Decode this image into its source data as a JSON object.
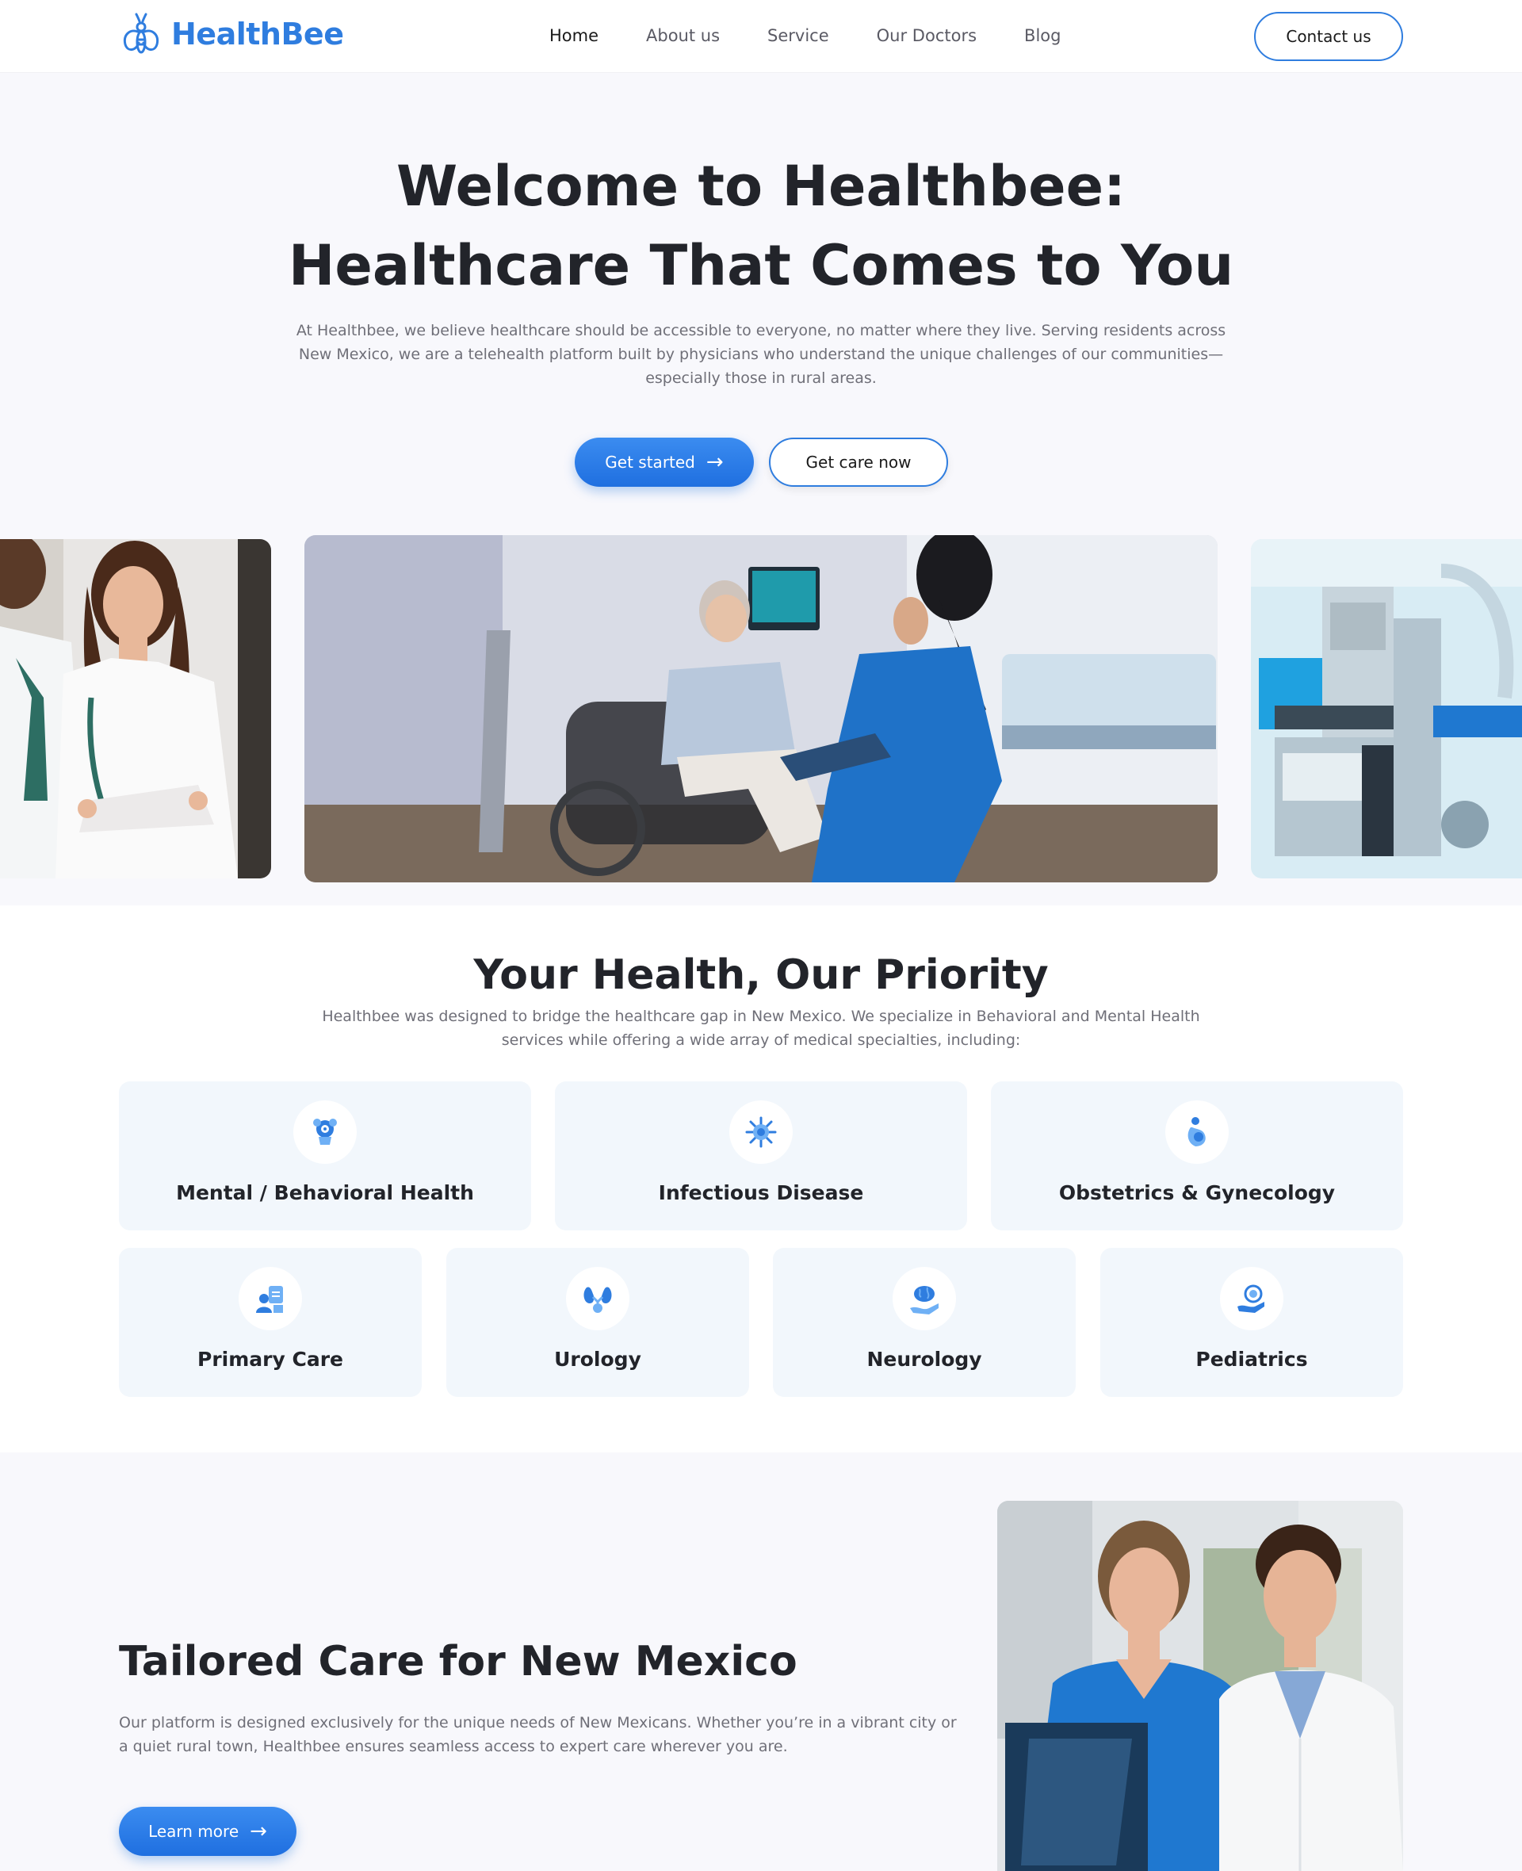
{
  "header": {
    "logo_text": "HealthBee",
    "nav": [
      "Home",
      "About us",
      "Service",
      "Our Doctors",
      "Blog"
    ],
    "contact_label": "Contact us"
  },
  "hero": {
    "title_line1": "Welcome to Healthbee:",
    "title_line2": "Healthcare That Comes to You",
    "description": "At Healthbee, we believe healthcare should be accessible to everyone, no matter where they live. Serving residents across New Mexico, we are a telehealth platform built by physicians who understand the unique challenges of our communities—especially those in rural areas.",
    "primary_label": "Get started",
    "secondary_label": "Get care now"
  },
  "priority": {
    "title": "Your Health, Our Priority",
    "description": "Healthbee was designed to bridge the healthcare gap in New Mexico. We specialize in Behavioral and Mental Health services while offering a wide array of medical specialties, including:",
    "specialties_row1": [
      {
        "label": "Mental / Behavioral Health",
        "icon": "brain-head-icon"
      },
      {
        "label": "Infectious Disease",
        "icon": "virus-icon"
      },
      {
        "label": "Obstetrics & Gynecology",
        "icon": "pregnancy-icon"
      }
    ],
    "specialties_row2": [
      {
        "label": "Primary Care",
        "icon": "doctor-clipboard-icon"
      },
      {
        "label": "Urology",
        "icon": "kidneys-icon"
      },
      {
        "label": "Neurology",
        "icon": "brain-hand-icon"
      },
      {
        "label": "Pediatrics",
        "icon": "baby-care-icon"
      }
    ]
  },
  "tailored": {
    "title": "Tailored Care for New Mexico",
    "description": "Our platform is designed exclusively for the unique needs of New Mexicans. Whether you’re in a vibrant city or a quiet rural town, Healthbee ensures seamless access to expert care wherever you are.",
    "button_label": "Learn more"
  },
  "colors": {
    "brand_blue": "#2f7ddf",
    "card_bg": "#f2f7fc",
    "page_bg": "#f8f8fc"
  }
}
